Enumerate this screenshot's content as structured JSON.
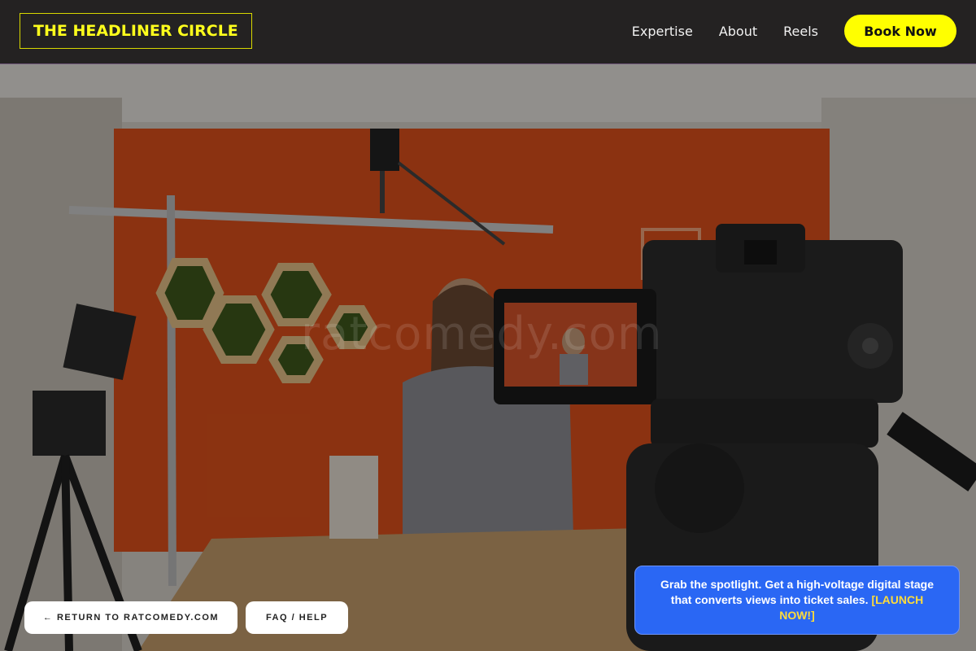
{
  "nav": {
    "logo": "THE HEADLINER CIRCLE",
    "links": [
      "Expertise",
      "About",
      "Reels"
    ],
    "cta": "Book Now"
  },
  "watermark": "ratcomedy.com",
  "buttons": {
    "return": "← RETURN TO RATCOMEDY.COM",
    "faq": "FAQ / HELP"
  },
  "promo": {
    "text": "Grab the spotlight. Get a high-voltage digital stage that converts views into ticket sales.",
    "link": "[LAUNCH NOW!]"
  },
  "colors": {
    "accent": "#ffff00",
    "promo_bg": "#2a67f4",
    "promo_link": "#ffdc3a"
  }
}
